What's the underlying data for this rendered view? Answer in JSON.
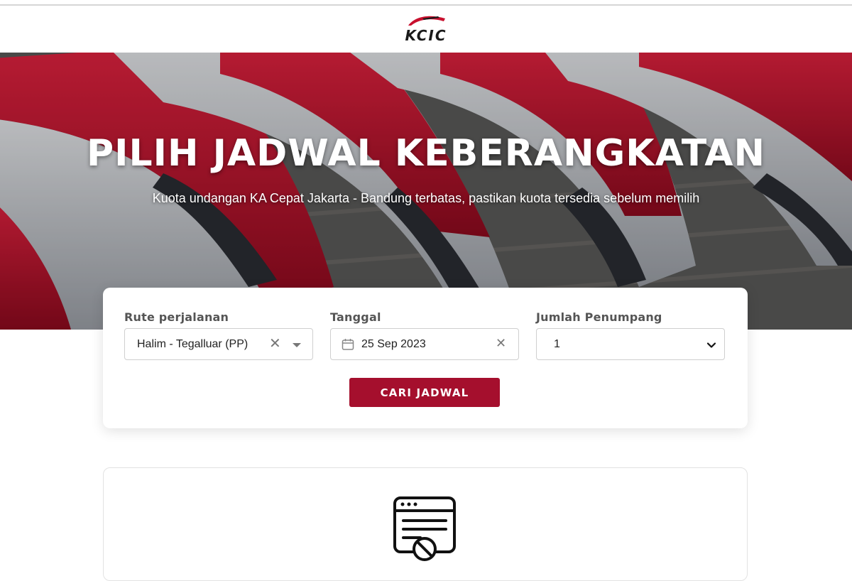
{
  "header": {
    "logo_text": "KCIC"
  },
  "hero": {
    "title": "PILIH JADWAL KEBERANGKATAN",
    "subtitle": "Kuota undangan KA Cepat Jakarta - Bandung terbatas, pastikan kuota tersedia sebelum memilih"
  },
  "search": {
    "route": {
      "label": "Rute perjalanan",
      "value": "Halim - Tegalluar (PP)",
      "clear_icon": "close-icon",
      "dropdown_icon": "caret-down-icon"
    },
    "date": {
      "label": "Tanggal",
      "value": "25 Sep 2023",
      "calendar_icon": "calendar-icon",
      "clear_icon": "close-icon"
    },
    "passengers": {
      "label": "Jumlah Penumpang",
      "value": "1",
      "dropdown_icon": "chevron-down-icon"
    },
    "submit_label": "CARI JADWAL"
  },
  "results": {
    "empty_icon": "no-schedule-icon"
  },
  "colors": {
    "accent": "#a50f2d",
    "train_red": "#c8102e",
    "train_silver": "#c9ccd1"
  }
}
